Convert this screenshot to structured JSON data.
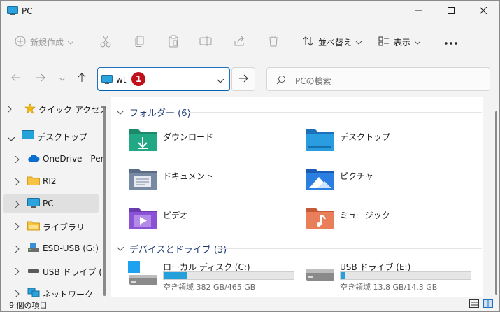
{
  "window": {
    "title": "PC",
    "controls": [
      "minimize",
      "maximize",
      "close"
    ]
  },
  "toolbar": {
    "new_label": "新規作成",
    "sort_label": "並べ替え",
    "view_label": "表示",
    "icons": [
      "cut-icon",
      "copy-icon",
      "paste-icon",
      "rename-icon",
      "share-icon",
      "delete-icon",
      "more-icon"
    ]
  },
  "navigation": {
    "address_text": "wt",
    "badge": "1",
    "search_placeholder": "PCの検索"
  },
  "sidebar": {
    "items": [
      {
        "label": "クイック アクセス",
        "icon": "star-icon",
        "expanded": false
      },
      {
        "label": "デスクトップ",
        "icon": "desktop-icon",
        "expanded": true
      },
      {
        "label": "OneDrive - Pers",
        "icon": "cloud-icon",
        "expanded": false
      },
      {
        "label": "RI2",
        "icon": "folder-icon",
        "expanded": false
      },
      {
        "label": "PC",
        "icon": "pc-icon",
        "expanded": false,
        "selected": true
      },
      {
        "label": "ライブラリ",
        "icon": "library-icon",
        "expanded": false
      },
      {
        "label": "ESD-USB (G:)",
        "icon": "usb-drive-icon",
        "expanded": false
      },
      {
        "label": "USB ドライブ (E:)",
        "icon": "usb-drive-icon",
        "expanded": false
      },
      {
        "label": "ネットワーク",
        "icon": "network-icon",
        "expanded": false
      }
    ]
  },
  "content": {
    "folders_header": "フォルダー (6)",
    "folders": [
      {
        "label": "ダウンロード",
        "icon": "downloads-folder-icon"
      },
      {
        "label": "デスクトップ",
        "icon": "desktop-folder-icon"
      },
      {
        "label": "ドキュメント",
        "icon": "documents-folder-icon"
      },
      {
        "label": "ピクチャ",
        "icon": "pictures-folder-icon"
      },
      {
        "label": "ビデオ",
        "icon": "videos-folder-icon"
      },
      {
        "label": "ミュージック",
        "icon": "music-folder-icon"
      }
    ],
    "drives_header": "デバイスとドライブ (3)",
    "drives": [
      {
        "name": "ローカル ディスク (C:)",
        "info": "空き領域 382 GB/465 GB",
        "used_fraction": 0.18
      },
      {
        "name": "USB ドライブ (E:)",
        "info": "空き領域 13.8 GB/14.3 GB",
        "used_fraction": 0.03
      }
    ]
  },
  "status": {
    "text": "9 個の項目"
  },
  "colors": {
    "accent": "#0063b1",
    "badge": "#c0101a",
    "drive_bar": "#26a0da",
    "section_header": "#1f3d78"
  }
}
